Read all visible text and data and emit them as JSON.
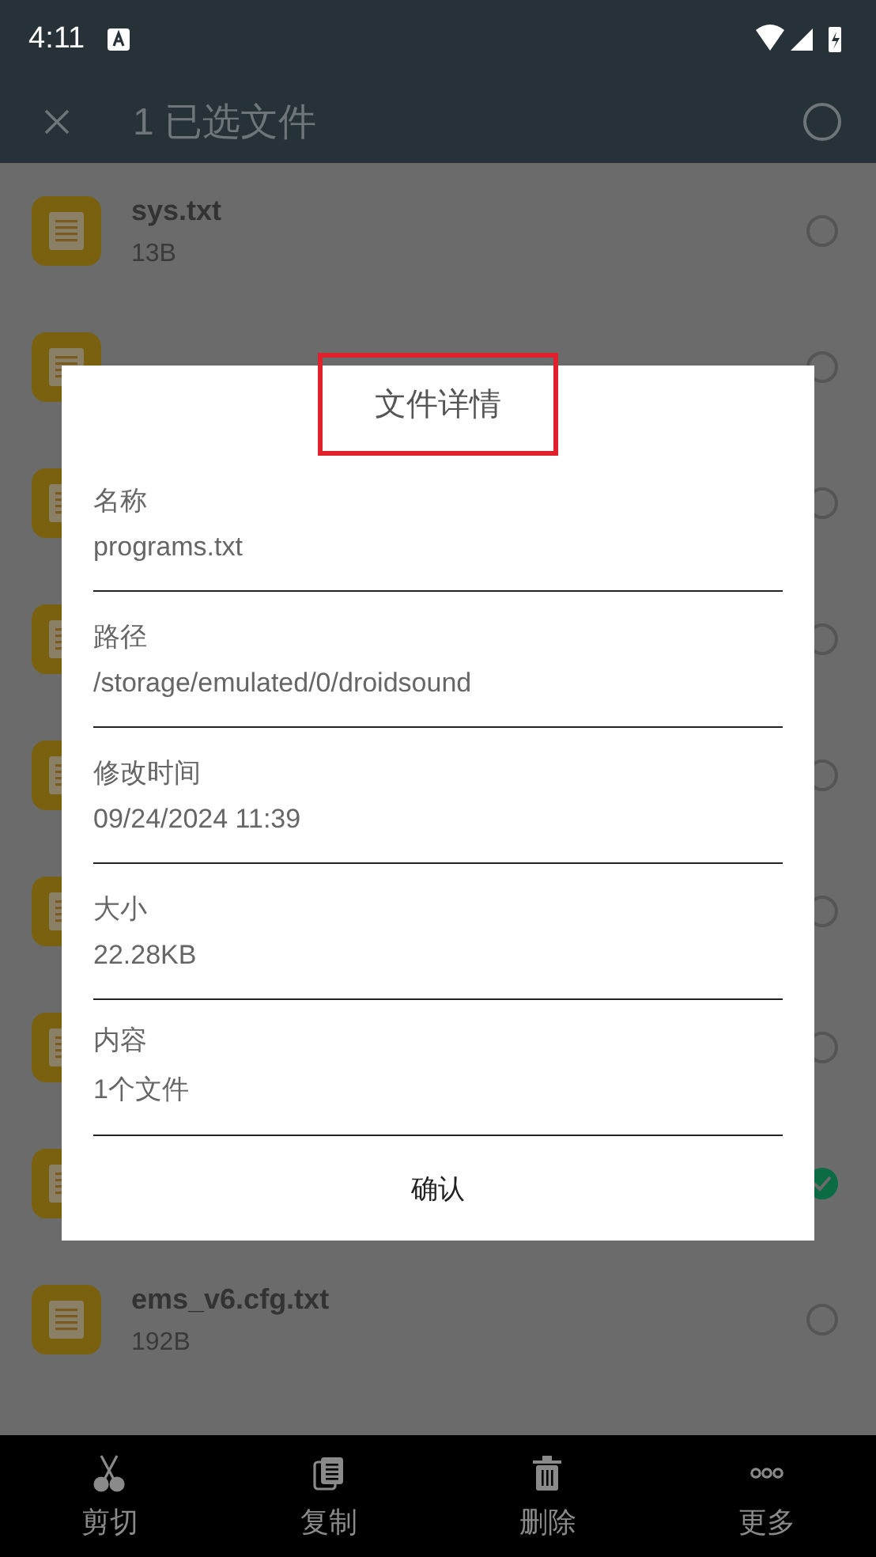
{
  "status_bar": {
    "time": "4:11"
  },
  "app_bar": {
    "title": "1 已选文件",
    "all_selected": false
  },
  "files": [
    {
      "name": "sys.txt",
      "size": "13B",
      "selected": false
    },
    {
      "selected": false
    },
    {
      "selected": false
    },
    {
      "selected": false
    },
    {
      "selected": false
    },
    {
      "selected": false
    },
    {
      "selected": false
    },
    {
      "selected": true
    },
    {
      "name": "ems_v6.cfg.txt",
      "size": "192B",
      "selected": false
    }
  ],
  "dialog": {
    "title": "文件详情",
    "title_highlighted": true,
    "fields": [
      {
        "label": "名称",
        "value": "programs.txt"
      },
      {
        "label": "路径",
        "value": "/storage/emulated/0/droidsound"
      },
      {
        "label": "修改时间",
        "value": "09/24/2024 11:39"
      },
      {
        "label": "大小",
        "value": "22.28KB"
      },
      {
        "label": "内容",
        "value": "1个文件"
      }
    ],
    "confirm": "确认"
  },
  "bottom_bar": [
    {
      "kind": "cut",
      "label": "剪切"
    },
    {
      "kind": "copy",
      "label": "复制"
    },
    {
      "kind": "delete",
      "label": "删除"
    },
    {
      "kind": "more",
      "label": "更多"
    }
  ]
}
